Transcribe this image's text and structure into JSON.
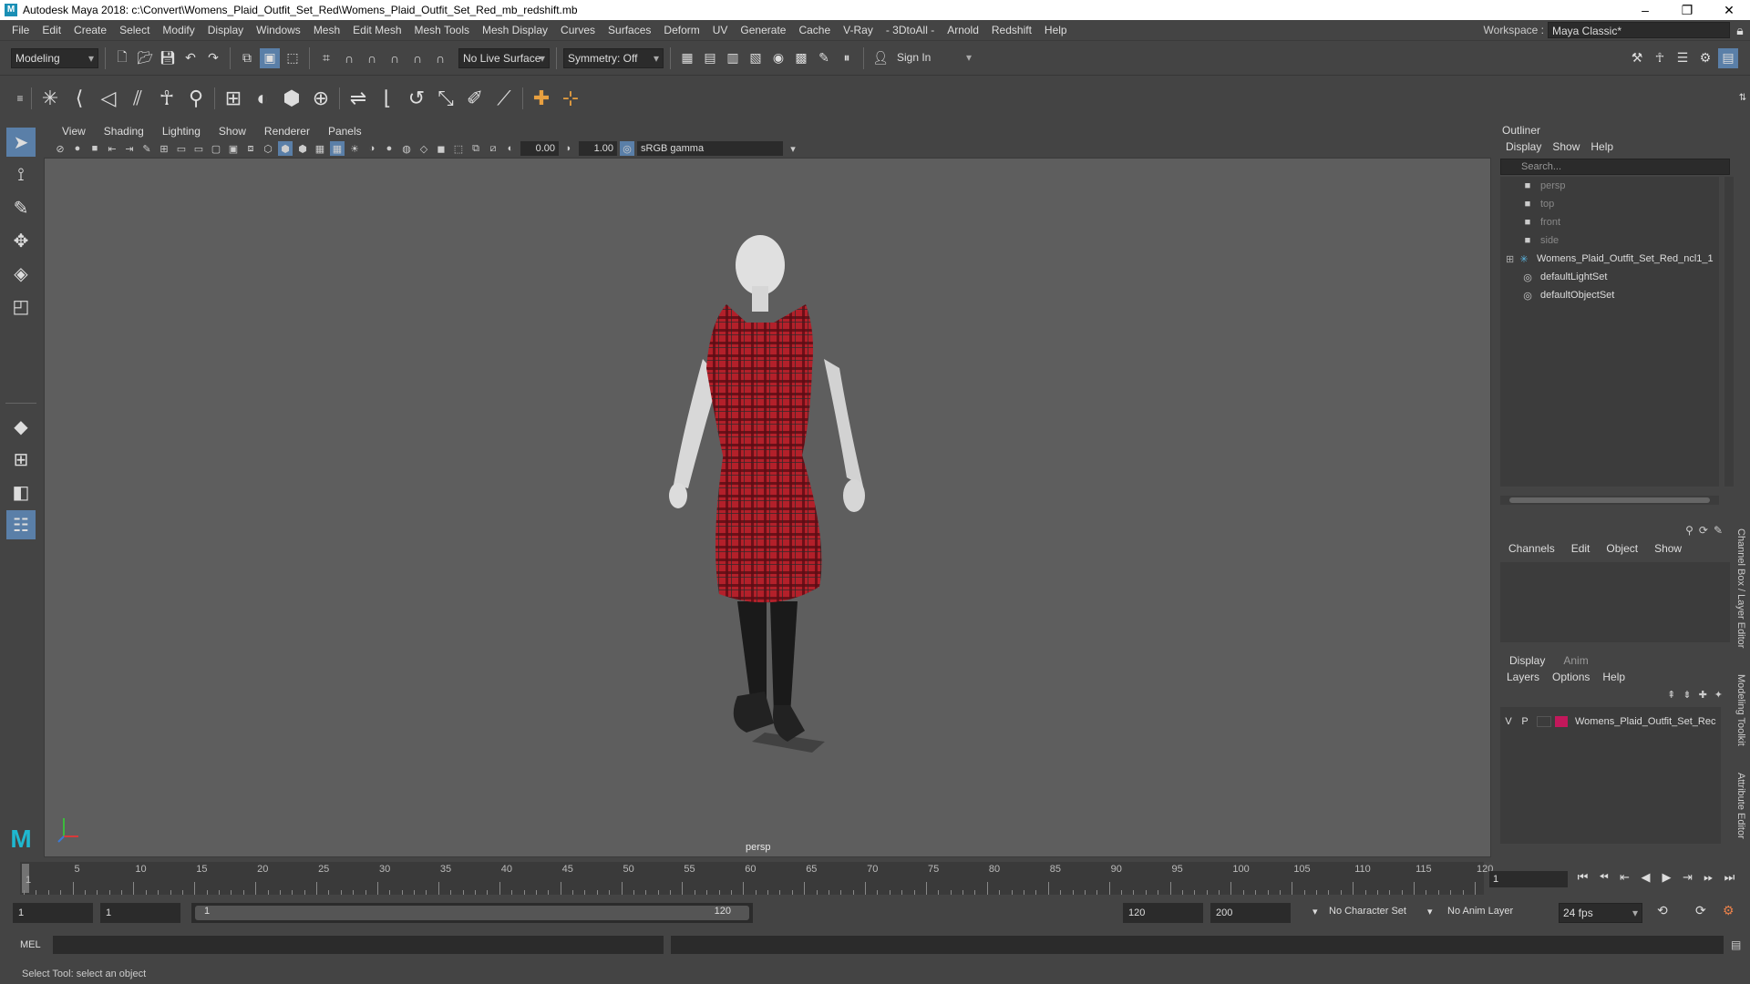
{
  "titlebar": {
    "title": "Autodesk Maya 2018: c:\\Convert\\Womens_Plaid_Outfit_Set_Red\\Womens_Plaid_Outfit_Set_Red_mb_redshift.mb",
    "minimize": "–",
    "maximize": "❐",
    "close": "✕"
  },
  "menubar": {
    "items": [
      "File",
      "Edit",
      "Create",
      "Select",
      "Modify",
      "Display",
      "Windows",
      "Mesh",
      "Edit Mesh",
      "Mesh Tools",
      "Mesh Display",
      "Curves",
      "Surfaces",
      "Deform",
      "UV",
      "Generate",
      "Cache",
      "V-Ray",
      "- 3DtoAll -",
      "Arnold",
      "Redshift",
      "Help"
    ],
    "workspace_label": "Workspace :",
    "workspace_value": "Maya Classic*"
  },
  "statusline": {
    "mode": "Modeling",
    "live_surface": "No Live Surface",
    "symmetry": "Symmetry: Off",
    "sign_in": "Sign In"
  },
  "viewport": {
    "menu": [
      "View",
      "Shading",
      "Lighting",
      "Show",
      "Renderer",
      "Panels"
    ],
    "exposure": "0.00",
    "gamma": "1.00",
    "color_space": "sRGB gamma",
    "camera": "persp"
  },
  "outliner": {
    "title": "Outliner",
    "menu": [
      "Display",
      "Show",
      "Help"
    ],
    "search_placeholder": "Search...",
    "items": [
      {
        "label": "persp",
        "icon": "camera-icon"
      },
      {
        "label": "top",
        "icon": "camera-icon"
      },
      {
        "label": "front",
        "icon": "camera-icon"
      },
      {
        "label": "side",
        "icon": "camera-icon"
      },
      {
        "label": "Womens_Plaid_Outfit_Set_Red_ncl1_1",
        "icon": "group-icon"
      },
      {
        "label": "defaultLightSet",
        "icon": "set-icon"
      },
      {
        "label": "defaultObjectSet",
        "icon": "set-icon"
      }
    ]
  },
  "channelbox": {
    "menu": [
      "Channels",
      "Edit",
      "Object",
      "Show"
    ]
  },
  "layers": {
    "tabs": [
      "Display",
      "Anim"
    ],
    "menu": [
      "Layers",
      "Options",
      "Help"
    ],
    "row": {
      "v": "V",
      "p": "P",
      "name": "Womens_Plaid_Outfit_Set_Rec",
      "color": "#c2185b"
    }
  },
  "side_tabs": [
    "Channel Box / Layer Editor",
    "Modeling Toolkit",
    "Attribute Editor"
  ],
  "timeslider": {
    "labels": [
      "1",
      "5",
      "10",
      "15",
      "20",
      "25",
      "30",
      "35",
      "40",
      "45",
      "50",
      "55",
      "60",
      "65",
      "70",
      "75",
      "80",
      "85",
      "90",
      "95",
      "100",
      "105",
      "110",
      "115",
      "120"
    ],
    "current_frame": "1"
  },
  "range": {
    "start": "1",
    "playback_start": "1",
    "slider_start": "1",
    "slider_end": "120",
    "playback_end": "120",
    "end": "200",
    "character_set": "No Character Set",
    "anim_layer": "No Anim Layer",
    "fps": "24 fps"
  },
  "mel": {
    "label": "MEL"
  },
  "helpline": {
    "text": "Select Tool: select an object"
  }
}
